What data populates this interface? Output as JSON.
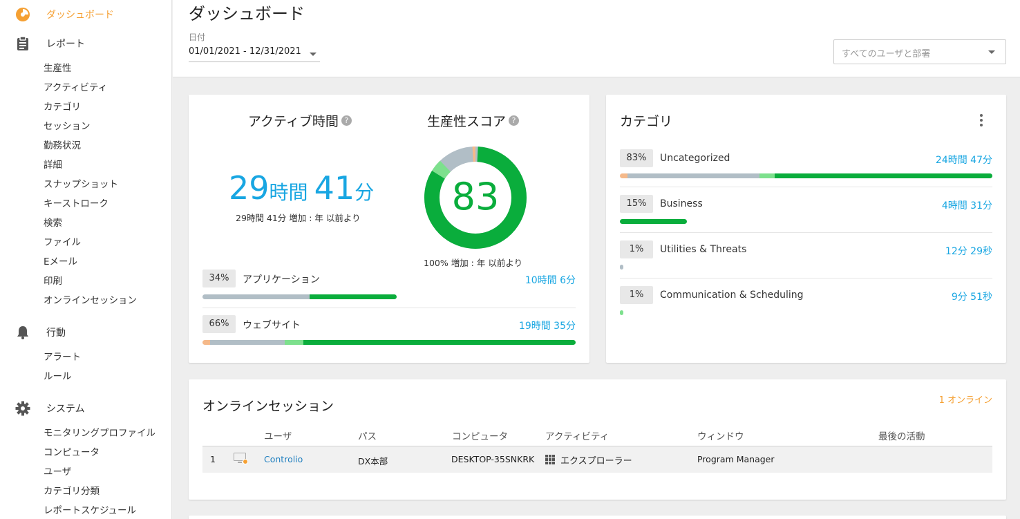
{
  "sidebar": {
    "sections": [
      {
        "label": "ダッシュボード",
        "icon": "dashboard-icon",
        "active": true
      },
      {
        "label": "レポート",
        "icon": "clipboard-icon"
      },
      {
        "label": "行動",
        "icon": "bell-icon"
      },
      {
        "label": "システム",
        "icon": "gear-icon"
      }
    ],
    "report_items": [
      "生産性",
      "アクティビティ",
      "カテゴリ",
      "セッション",
      "勤務状況",
      "詳細",
      "スナップショット",
      "キーストローク",
      "検索",
      "ファイル",
      "Eメール",
      "印刷",
      "オンラインセッション"
    ],
    "behavior_items": [
      "アラート",
      "ルール"
    ],
    "system_items": [
      "モニタリングプロファイル",
      "コンピュータ",
      "ユーザ",
      "カテゴリ分類",
      "レポートスケジュール"
    ]
  },
  "header": {
    "title": "ダッシュボード",
    "date_label": "日付",
    "date_range": "01/01/2021 - 12/31/2021",
    "user_select_placeholder": "すべてのユーザと部署"
  },
  "active_time": {
    "title": "アクティブ時間",
    "hours": "29",
    "hours_unit": "時間",
    "minutes": "41",
    "minutes_unit": "分",
    "delta_text": "29時間 41分 増加 : 年 以前より"
  },
  "productivity": {
    "title": "生産性スコア",
    "score": "83",
    "delta_text": "100% 増加 : 年 以前より",
    "donut": {
      "productive": 83,
      "neutral_light": 4,
      "unproductive": 12,
      "orange": 1
    }
  },
  "usage": [
    {
      "pct": "34%",
      "label": "アプリケーション",
      "time": "10時間 6分"
    },
    {
      "pct": "66%",
      "label": "ウェブサイト",
      "time": "19時間 35分"
    }
  ],
  "categories": {
    "title": "カテゴリ",
    "items": [
      {
        "pct": "83%",
        "name": "Uncategorized",
        "time": "24時間 47分"
      },
      {
        "pct": "15%",
        "name": "Business",
        "time": "4時間 31分"
      },
      {
        "pct": "1%",
        "name": "Utilities & Threats",
        "time": "12分 29秒"
      },
      {
        "pct": "1%",
        "name": "Communication & Scheduling",
        "time": "9分 51秒"
      }
    ]
  },
  "online": {
    "title": "オンラインセッション",
    "count_label": "1 オンライン",
    "columns": [
      "ユーザ",
      "パス",
      "コンピュータ",
      "アクティビティ",
      "ウィンドウ",
      "最後の活動"
    ],
    "rows": [
      {
        "num": "1",
        "user": "Controlio",
        "path": "DX本部",
        "computer": "DESKTOP-35SNKRK",
        "activity": "エクスプローラー",
        "window": "Program Manager",
        "last": ""
      }
    ]
  },
  "colors": {
    "accent_orange": "#f5a033",
    "green": "#0aad3c",
    "light_green": "#7de08d",
    "gray": "#b1bec6",
    "blue": "#18a6e2"
  }
}
